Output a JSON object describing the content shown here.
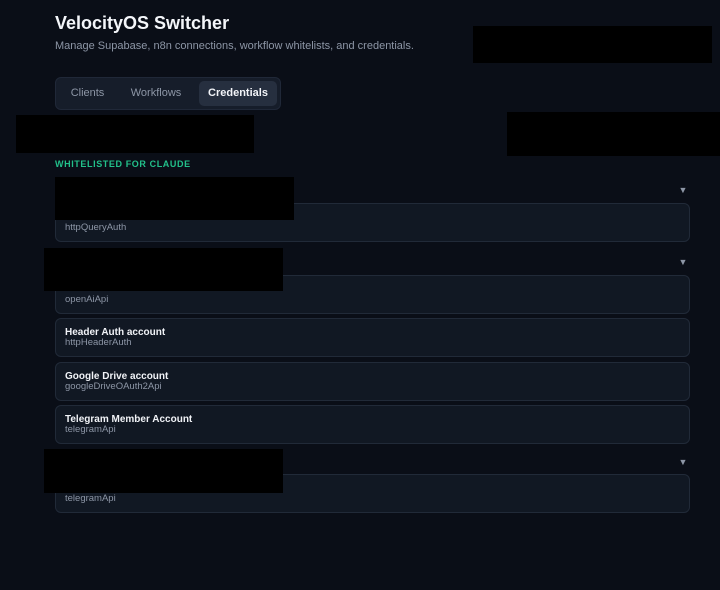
{
  "header": {
    "title": "VelocityOS Switcher",
    "subtitle": "Manage Supabase, n8n connections, workflow whitelists, and credentials."
  },
  "tabs": [
    {
      "label": "Clients"
    },
    {
      "label": "Workflows"
    },
    {
      "label": "Credentials",
      "active": true
    }
  ],
  "section": {
    "label": "WHITELISTED FOR CLAUDE"
  },
  "groups": [
    {
      "toggle_icon": "▼",
      "credentials": [
        {
          "name": "",
          "type": "httpQueryAuth"
        }
      ]
    },
    {
      "toggle_icon": "▼",
      "credentials": [
        {
          "name": "",
          "type": "openAiApi"
        },
        {
          "name": "Header Auth account",
          "type": "httpHeaderAuth"
        },
        {
          "name": "Google Drive account",
          "type": "googleDriveOAuth2Api"
        },
        {
          "name": "Telegram Member Account",
          "type": "telegramApi"
        }
      ]
    },
    {
      "toggle_icon": "▼",
      "credentials": [
        {
          "name": "",
          "type": "telegramApi"
        }
      ]
    }
  ],
  "colors": {
    "background": "#0a0e17",
    "accent": "#22c08a",
    "card": "#111823",
    "muted_text": "#8d96a6"
  }
}
